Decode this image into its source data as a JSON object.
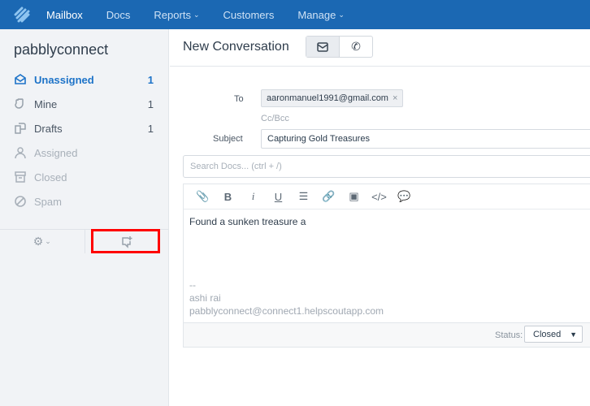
{
  "topnav": {
    "items": [
      {
        "label": "Mailbox",
        "active": true
      },
      {
        "label": "Docs"
      },
      {
        "label": "Reports",
        "dropdown": true
      },
      {
        "label": "Customers"
      },
      {
        "label": "Manage",
        "dropdown": true
      }
    ],
    "brand_color": "#1b68b3"
  },
  "sidebar": {
    "mailbox_name": "pabblyconnect",
    "items": [
      {
        "label": "Unassigned",
        "count": "1",
        "icon": "inbox-icon"
      },
      {
        "label": "Mine",
        "count": "1",
        "icon": "hand-icon"
      },
      {
        "label": "Drafts",
        "count": "1",
        "icon": "drafts-icon"
      },
      {
        "label": "Assigned",
        "icon": "person-icon"
      },
      {
        "label": "Closed",
        "icon": "archive-icon"
      },
      {
        "label": "Spam",
        "icon": "block-icon"
      }
    ]
  },
  "main": {
    "title": "New Conversation",
    "to_label": "To",
    "to_value": "aaronmanuel1991@gmail.com",
    "ccbcc": "Cc/Bcc",
    "subject_label": "Subject",
    "subject_value": "Capturing Gold Treasures",
    "search_placeholder": "Search Docs... (ctrl + /)",
    "body": "Found a sunken treasure a",
    "signature": {
      "dash": "--",
      "name": "ashi rai",
      "email": "pabblyconnect@connect1.helpscoutapp.com"
    },
    "status_label": "Status:",
    "status_value": "Closed"
  }
}
